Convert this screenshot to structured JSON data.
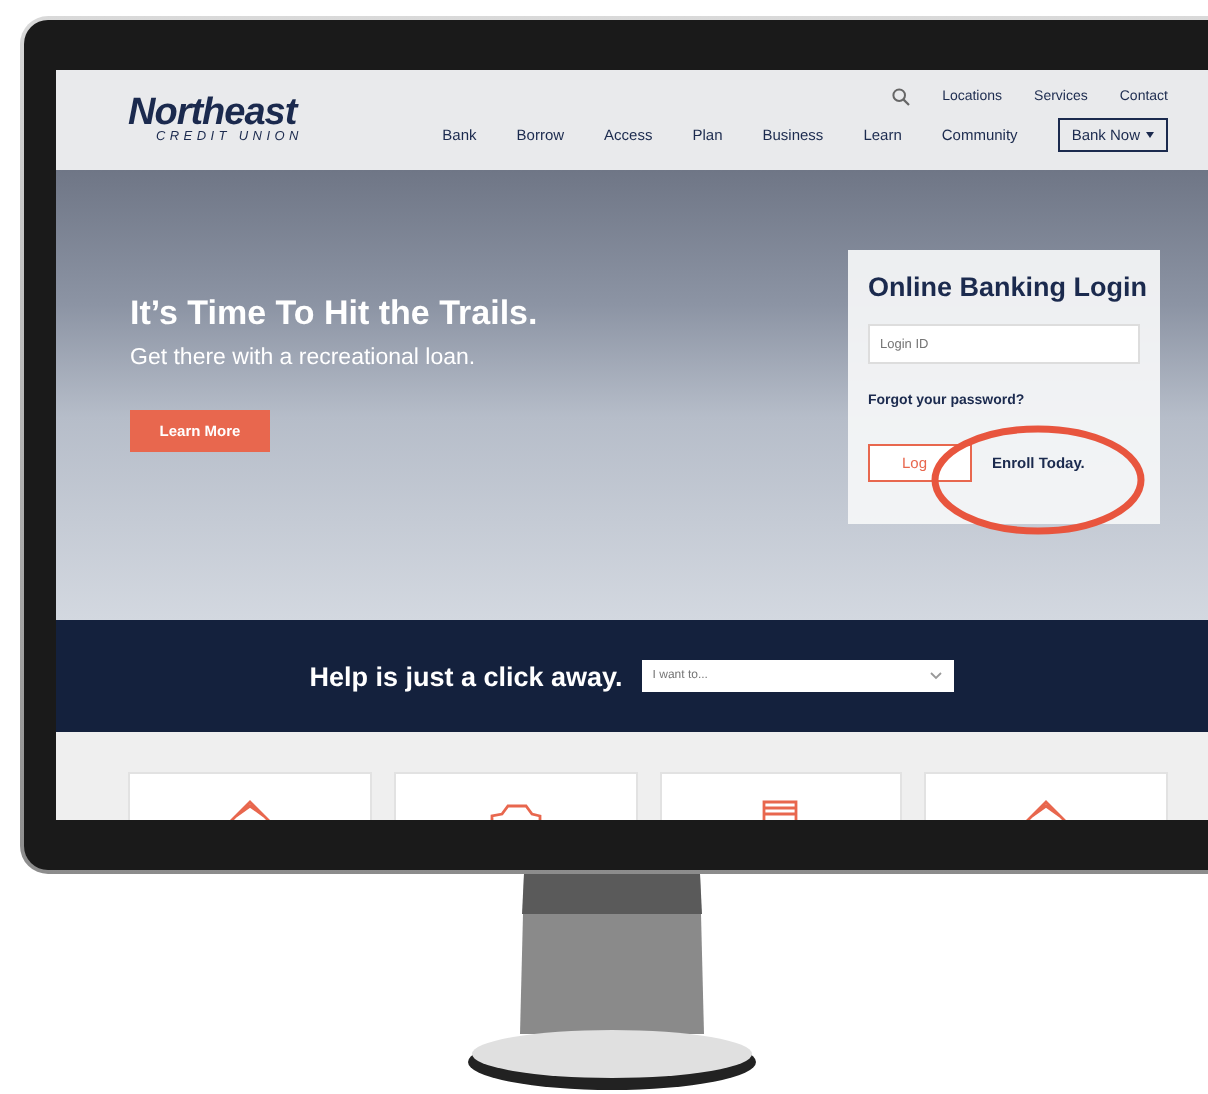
{
  "header": {
    "logo": {
      "name": "Northeast",
      "tagline": "CREDIT UNION"
    },
    "utility_links": [
      "Locations",
      "Services",
      "Contact"
    ],
    "nav": [
      "Bank",
      "Borrow",
      "Access",
      "Plan",
      "Business",
      "Learn",
      "Community"
    ],
    "cta": "Bank Now"
  },
  "hero": {
    "headline": "It’s Time To Hit the Trails.",
    "subhead": "Get there with a recreational loan.",
    "button": "Learn More"
  },
  "login": {
    "title": "Online Banking Login",
    "field": {
      "placeholder": "Login ID"
    },
    "forgot": "Forgot your password?",
    "button": "Log",
    "enroll": "Enroll Today.",
    "enroll_circled": true
  },
  "help": {
    "title": "Help is just a click away.",
    "select": {
      "placeholder": "I want to..."
    }
  },
  "cards": [
    {
      "kind": "house"
    },
    {
      "kind": "car"
    },
    {
      "kind": "card"
    },
    {
      "kind": "house"
    }
  ]
}
